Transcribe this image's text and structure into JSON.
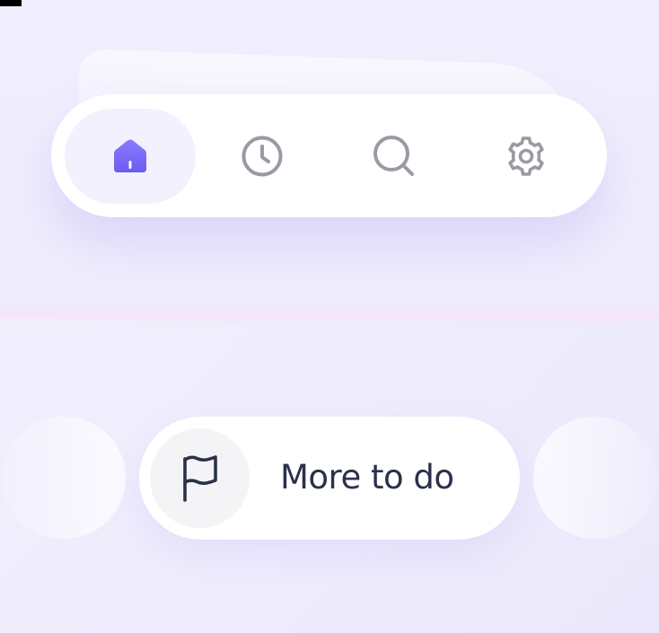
{
  "nav": {
    "items": [
      {
        "id": "home",
        "icon": "home-icon",
        "active": true
      },
      {
        "id": "history",
        "icon": "clock-icon",
        "active": false
      },
      {
        "id": "search",
        "icon": "search-icon",
        "active": false
      },
      {
        "id": "settings",
        "icon": "gear-icon",
        "active": false
      }
    ],
    "colors": {
      "active_icon": "#7b6cf6",
      "inactive_icon": "#9a9aa4",
      "active_bg": "#f3f1fe"
    }
  },
  "action": {
    "label": "More to do",
    "icon": "flag-icon",
    "text_color": "#2b3149"
  }
}
